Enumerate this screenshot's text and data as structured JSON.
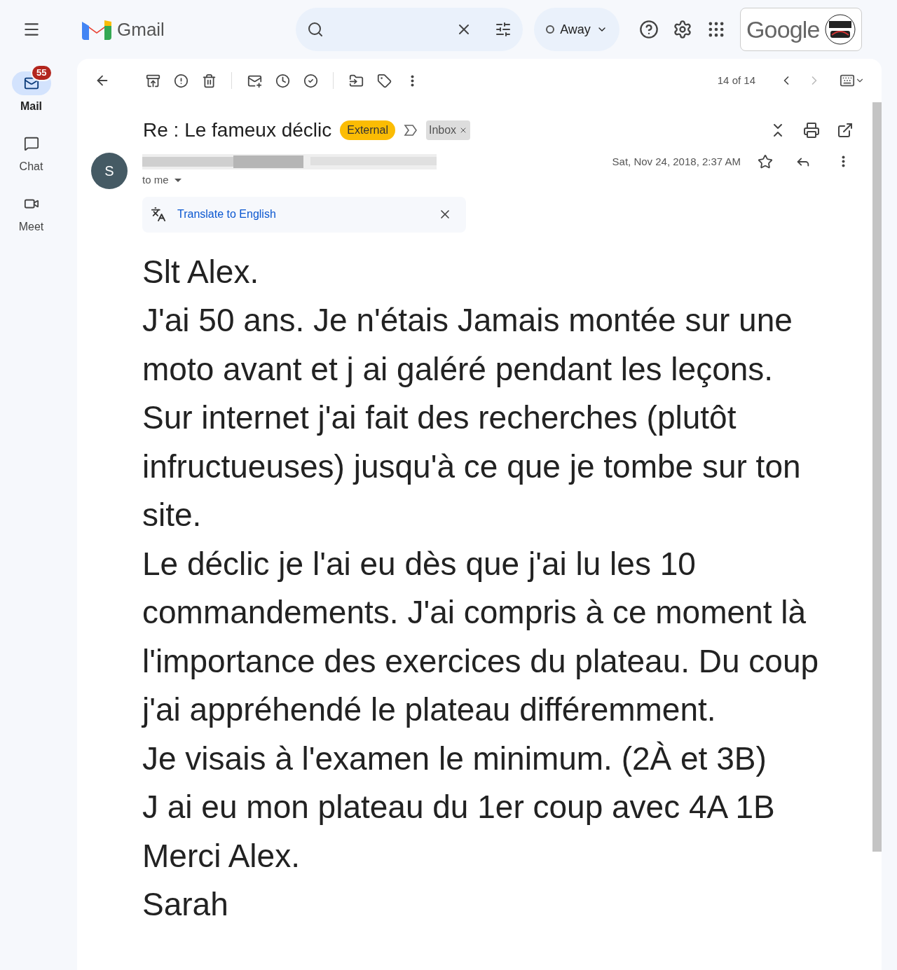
{
  "app": {
    "name": "Gmail"
  },
  "status": {
    "label": "Away"
  },
  "account": {
    "brand": "Google"
  },
  "nav": [
    {
      "label": "Mail",
      "kind": "mail",
      "selected": true,
      "badge": "55"
    },
    {
      "label": "Chat",
      "kind": "chat",
      "selected": false
    },
    {
      "label": "Meet",
      "kind": "meet",
      "selected": false
    }
  ],
  "toolbar": {
    "counter": "14 of 14"
  },
  "message": {
    "subject": "Re : Le fameux déclic",
    "labels": [
      {
        "text": "External",
        "kind": "warning"
      },
      {
        "text": "Inbox",
        "kind": "folder"
      }
    ],
    "avatar": "S",
    "recipient": "to me",
    "date": "Sat, Nov 24, 2018, 2:37 AM",
    "starred": false,
    "translate": "Translate to English",
    "body": [
      "Slt Alex.",
      "J'ai 50 ans. Je n'étais Jamais montée sur une moto avant et j ai galéré pendant les leçons.",
      "Sur internet j'ai fait des recherches (plutôt infructueuses) jusqu'à ce que je tombe sur ton site.",
      "Le déclic je l'ai eu dès que j'ai lu les 10 commandements. J'ai compris à ce moment là l'importance des exercices du plateau. Du coup j'ai appréhendé le plateau différemment.",
      "Je visais à l'examen le minimum. (2À et 3B)",
      "J ai eu mon plateau du 1er coup avec 4A 1B",
      "Merci Alex.",
      "Sarah"
    ]
  }
}
